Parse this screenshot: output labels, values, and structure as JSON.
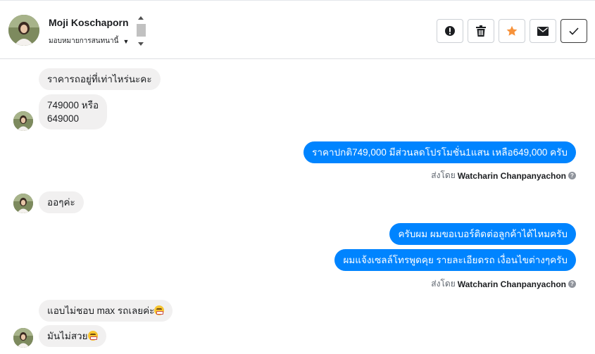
{
  "header": {
    "contact_name": "Moji Koschaporn",
    "assign_label": "มอบหมายการสนทนานี้",
    "caret_icon": "caret-down-icon",
    "actions": [
      {
        "name": "report-spam-button",
        "icon": "exclamation-circle-icon"
      },
      {
        "name": "delete-button",
        "icon": "trash-icon"
      },
      {
        "name": "star-button",
        "icon": "star-icon",
        "color": "#f7923a"
      },
      {
        "name": "mark-unread-button",
        "icon": "envelope-icon"
      },
      {
        "name": "mark-done-button",
        "icon": "checkmark-icon"
      }
    ]
  },
  "messages": {
    "m1": "ราคารถอยู่ที่เท่าไหร่นะคะ",
    "m2_line1": "749000 หรือ",
    "m2_line2": "649000",
    "m3": "ราคาปกติ749,000 มีส่วนลดโปรโมชั่น1แสน เหลือ649,000 ครับ",
    "m4": "ออๆค่ะ",
    "m5": "ครับผม ผมขอเบอร์ติดต่อลูกค้าได้ไหมครับ",
    "m6": "ผมแจ้งเซลล์โทรพูดคุย รายละเอียดรถ เงื่อนไขต่างๆครับ",
    "m7": "แอบไม่ชอบ max รถเลยค่ะ",
    "m8": "มันไม่สวย"
  },
  "sent_by": {
    "prefix": "ส่งโดย",
    "agent": "Watcharin Chanpanyachon",
    "help_glyph": "?"
  },
  "colors": {
    "outgoing_bubble": "#0084ff",
    "incoming_bubble": "#f1f0f0",
    "star": "#f7923a"
  }
}
